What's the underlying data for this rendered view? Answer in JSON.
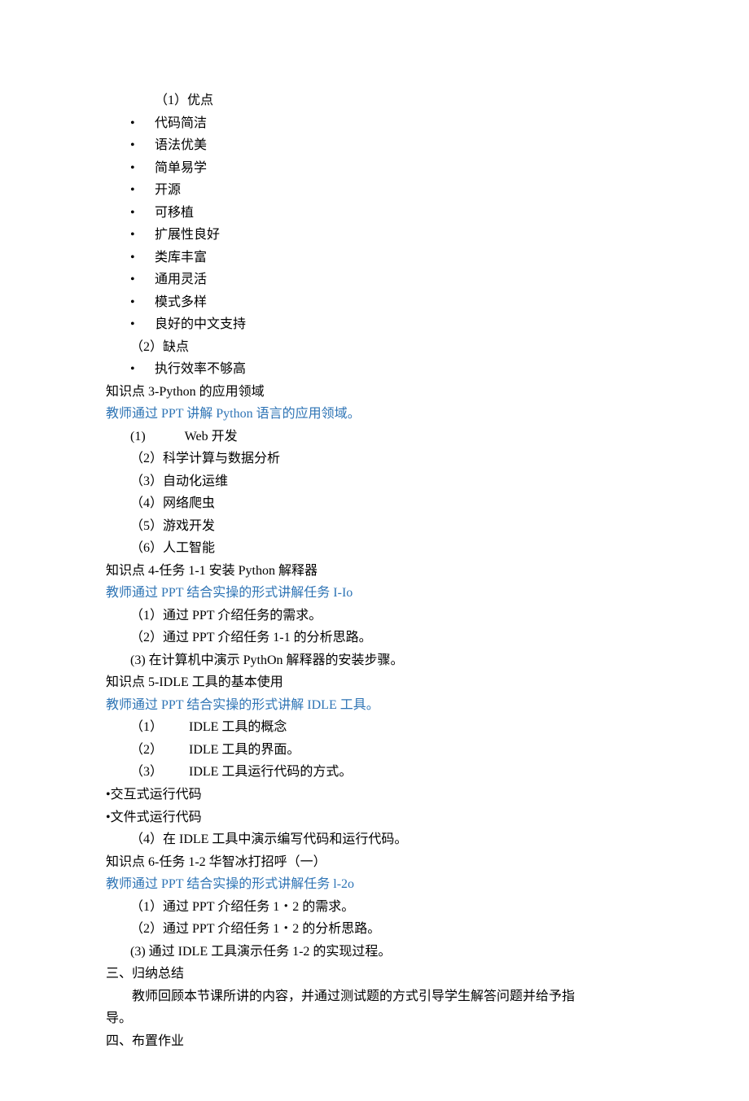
{
  "section_advantages": {
    "heading": "（1）优点",
    "items": [
      "代码简洁",
      "语法优美",
      "简单易学",
      "开源",
      "可移植",
      "扩展性良好",
      "类库丰富",
      "通用灵活",
      "模式多样",
      "良好的中文支持"
    ]
  },
  "section_disadvantages": {
    "heading": "（2）缺点",
    "items": [
      "执行效率不够高"
    ]
  },
  "kp3": {
    "title": "知识点 3-Python 的应用领域",
    "teacher_note": "教师通过 PPT 讲解 Python 语言的应用领域。",
    "items": [
      "(1)   Web 开发",
      "（2）科学计算与数据分析",
      "（3）自动化运维",
      "（4）网络爬虫",
      "（5）游戏开发",
      "（6）人工智能"
    ]
  },
  "kp4": {
    "title": "知识点 4-任务 1-1 安装 Python 解释器",
    "teacher_note": "教师通过 PPT 结合实操的形式讲解任务 I-Io",
    "items": [
      "（1）通过 PPT 介绍任务的需求。",
      "（2）通过 PPT 介绍任务 1-1 的分析思路。",
      "(3) 在计算机中演示 PythOn 解释器的安装步骤。"
    ]
  },
  "kp5": {
    "title": "知识点 5-IDLE 工具的基本使用",
    "teacher_note": "教师通过 PPT 结合实操的形式讲解 IDLE 工具。",
    "items": [
      "（1）  IDLE 工具的概念",
      "（2）  IDLE 工具的界面。",
      "（3）  IDLE 工具运行代码的方式。"
    ],
    "extra": [
      "•交互式运行代码",
      "•文件式运行代码",
      "（4）在 IDLE 工具中演示编写代码和运行代码。"
    ]
  },
  "kp6": {
    "title": "知识点 6-任务 1-2 华智冰打招呼（一）",
    "teacher_note": "教师通过 PPT 结合实操的形式讲解任务 l-2o",
    "items": [
      "（1）通过 PPT 介绍任务 1・2 的需求。",
      "（2）通过 PPT 介绍任务 1・2 的分析思路。",
      "(3) 通过 IDLE 工具演示任务 1-2 的实现过程。"
    ]
  },
  "summary": {
    "heading": "三、归纳总结",
    "body": "教师回顾本节课所讲的内容，并通过测试题的方式引导学生解答问题并给予指",
    "body_line2": "导。"
  },
  "homework": {
    "heading": "四、布置作业"
  },
  "bullet_symbol": "•"
}
